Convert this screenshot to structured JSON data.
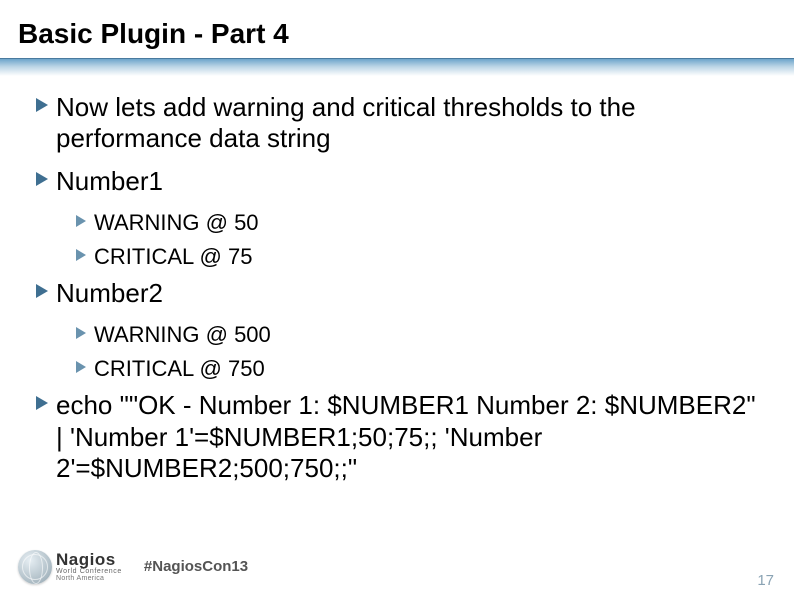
{
  "title": "Basic Plugin - Part 4",
  "bullets": {
    "b1": "Now lets add warning and critical thresholds to the performance data string",
    "b2": "Number1",
    "b2a": "WARNING @ 50",
    "b2b": "CRITICAL @ 75",
    "b3": "Number2",
    "b3a": "WARNING @ 500",
    "b3b": "CRITICAL @ 750",
    "b4": "echo \"\"OK - Number 1: $NUMBER1 Number 2: $NUMBER2\" | 'Number 1'=$NUMBER1;50;75;; 'Number 2'=$NUMBER2;500;750;;\""
  },
  "footer": {
    "logo_main": "Nagios",
    "logo_sub1": "World Conference",
    "logo_sub2": "North America",
    "hashtag": "#NagiosCon13",
    "page": "17"
  },
  "colors": {
    "arrow": "#3f6f91"
  }
}
